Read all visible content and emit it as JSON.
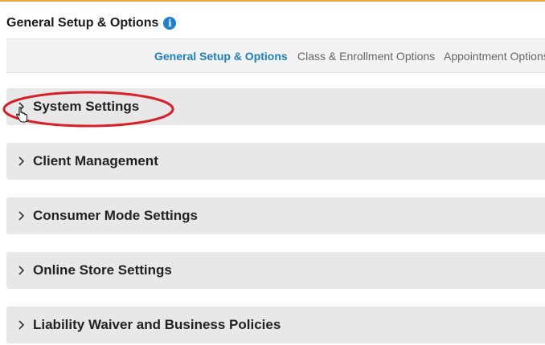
{
  "header": {
    "title": "General Setup & Options",
    "info_icon": "info-icon"
  },
  "tabs": [
    {
      "label": "General Setup & Options",
      "active": true
    },
    {
      "label": "Class & Enrollment Options",
      "active": false
    },
    {
      "label": "Appointment Options",
      "active": false
    }
  ],
  "sections": [
    {
      "label": "System Settings",
      "icon": "chevron-right-icon"
    },
    {
      "label": "Client Management",
      "icon": "chevron-right-icon"
    },
    {
      "label": "Consumer Mode Settings",
      "icon": "chevron-right-icon"
    },
    {
      "label": "Online Store Settings",
      "icon": "chevron-right-icon"
    },
    {
      "label": "Liability Waiver and Business Policies",
      "icon": "chevron-right-icon"
    }
  ],
  "colors": {
    "accent_top": "#f0a53a",
    "active_tab": "#1f7fc4",
    "section_bg": "#e8e8e8",
    "highlight": "#d6202a"
  }
}
